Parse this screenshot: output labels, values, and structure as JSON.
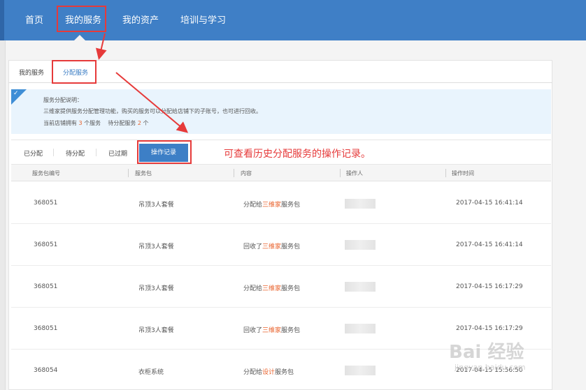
{
  "nav": {
    "items": [
      {
        "label": "首页"
      },
      {
        "label": "我的服务"
      },
      {
        "label": "我的资产"
      },
      {
        "label": "培训与学习"
      }
    ]
  },
  "subtabs": [
    {
      "label": "我的服务"
    },
    {
      "label": "分配服务"
    }
  ],
  "info": {
    "title": "服务分配说明：",
    "line1": "三维家提供服务分配管理功能，购买的服务可以分配给店铺下的子账号，也可进行回收。",
    "count_prefix": "当前店铺拥有",
    "owned_count": "3",
    "count_mid": "个服务    待分配服务",
    "pending_count": "2",
    "count_suffix": "个"
  },
  "status_tabs": [
    {
      "label": "已分配"
    },
    {
      "label": "待分配"
    },
    {
      "label": "已过期"
    },
    {
      "label": "操作记录"
    }
  ],
  "table": {
    "headers": [
      "服务包编号",
      "服务包",
      "内容",
      "操作人",
      "操作时间"
    ],
    "rows": [
      {
        "id": "368051",
        "package": "吊顶3人套餐",
        "c1": "分配给",
        "c2": "三维家",
        "c3": "服务包",
        "time": "2017-04-15 16:41:14"
      },
      {
        "id": "368051",
        "package": "吊顶3人套餐",
        "c1": "回收了",
        "c2": "三维家",
        "c3": "服务包",
        "time": "2017-04-15 16:41:14"
      },
      {
        "id": "368051",
        "package": "吊顶3人套餐",
        "c1": "分配给",
        "c2": "三维家",
        "c3": "服务包",
        "time": "2017-04-15 16:17:29"
      },
      {
        "id": "368051",
        "package": "吊顶3人套餐",
        "c1": "回收了",
        "c2": "三维家",
        "c3": "服务包",
        "time": "2017-04-15 16:17:29"
      },
      {
        "id": "368054",
        "package": "衣柜系统",
        "c1": "分配给",
        "c2": "设计",
        "c3": "服务包",
        "time": "2017-04-15 15:56:50"
      }
    ]
  },
  "annotation": {
    "note": "可查看历史分配服务的操作记录。"
  },
  "watermark": {
    "text": "Bai 经验",
    "sub": "jingyan.baidu.com"
  },
  "colors": {
    "nav_bg": "#3f7fc6",
    "accent": "#3d7fc6",
    "highlight": "#e9612b",
    "annotation_red": "#e63a3a"
  }
}
